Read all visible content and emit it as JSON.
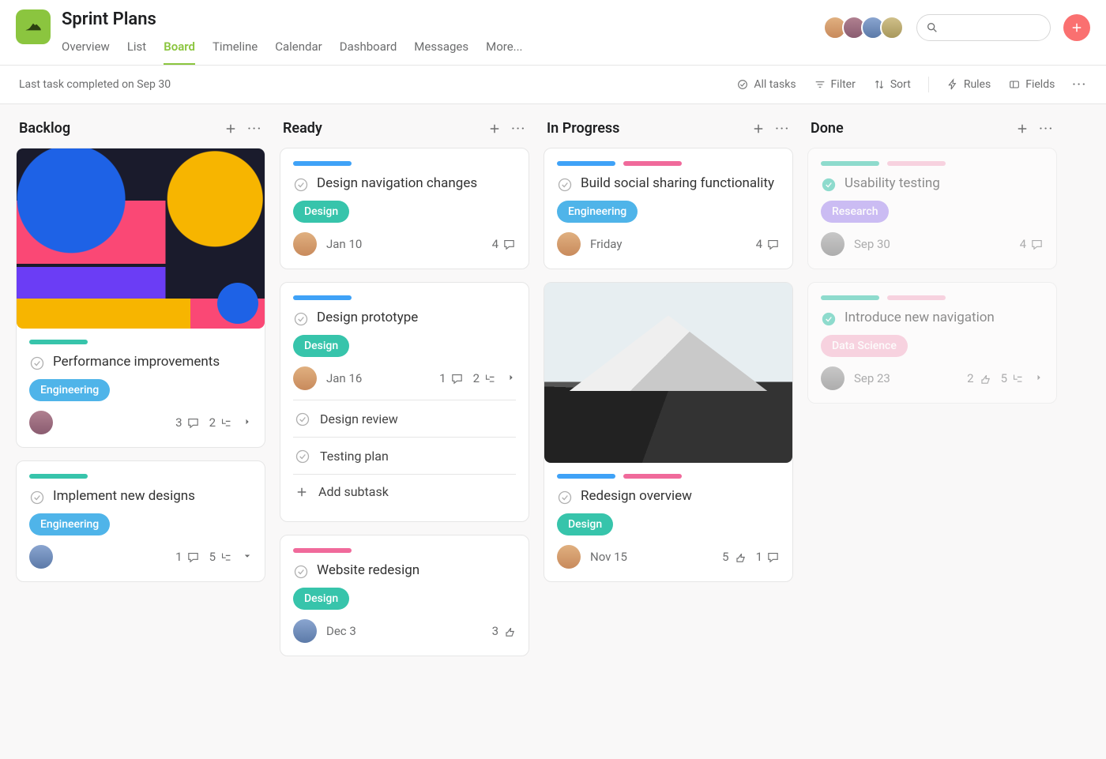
{
  "header": {
    "project_title": "Sprint Plans",
    "tabs": [
      "Overview",
      "List",
      "Board",
      "Timeline",
      "Calendar",
      "Dashboard",
      "Messages",
      "More..."
    ],
    "active_tab": "Board",
    "search_placeholder": ""
  },
  "toolbar": {
    "status_text": "Last task completed on Sep 30",
    "all_tasks": "All tasks",
    "filter": "Filter",
    "sort": "Sort",
    "rules": "Rules",
    "fields": "Fields"
  },
  "columns": [
    {
      "title": "Backlog",
      "cards": [
        {
          "cover": "abstract",
          "strips": [
            "teal"
          ],
          "title": "Performance improvements",
          "tags": [
            {
              "label": "Engineering",
              "kind": "eng"
            }
          ],
          "avatar": "c2",
          "date": "",
          "stats": {
            "comments": 3,
            "subtasks": 2,
            "caret": "right"
          },
          "done": false
        },
        {
          "strips": [
            "teal"
          ],
          "title": "Implement new designs",
          "tags": [
            {
              "label": "Engineering",
              "kind": "eng"
            }
          ],
          "avatar": "c3",
          "date": "",
          "stats": {
            "comments": 1,
            "subtasks": 5,
            "caret": "down"
          },
          "done": false
        }
      ]
    },
    {
      "title": "Ready",
      "cards": [
        {
          "strips": [
            "blue"
          ],
          "title": "Design navigation changes",
          "tags": [
            {
              "label": "Design",
              "kind": "design"
            }
          ],
          "avatar": "c1",
          "date": "Jan 10",
          "stats": {
            "comments": 4
          },
          "done": false
        },
        {
          "strips": [
            "blue"
          ],
          "title": "Design prototype",
          "tags": [
            {
              "label": "Design",
              "kind": "design"
            }
          ],
          "avatar": "c1",
          "date": "Jan 16",
          "stats": {
            "comments": 1,
            "subtasks": 2,
            "caret": "right"
          },
          "done": false,
          "subtasks": [
            {
              "title": "Design review"
            },
            {
              "title": "Testing plan"
            }
          ],
          "add_subtask_label": "Add subtask"
        },
        {
          "strips": [
            "pink"
          ],
          "title": "Website redesign",
          "tags": [
            {
              "label": "Design",
              "kind": "design"
            }
          ],
          "avatar": "c3",
          "date": "Dec 3",
          "stats": {
            "likes": 3
          },
          "done": false
        }
      ]
    },
    {
      "title": "In Progress",
      "cards": [
        {
          "strips": [
            "blue",
            "pink"
          ],
          "title": "Build social sharing functionality",
          "tags": [
            {
              "label": "Engineering",
              "kind": "eng"
            }
          ],
          "avatar": "c1",
          "date": "Friday",
          "stats": {
            "comments": 4
          },
          "done": false
        },
        {
          "cover": "mountain",
          "strips": [
            "blue",
            "pink"
          ],
          "title": "Redesign overview",
          "tags": [
            {
              "label": "Design",
              "kind": "design"
            }
          ],
          "avatar": "c1",
          "date": "Nov 15",
          "stats": {
            "likes": 5,
            "comments": 1
          },
          "done": false
        }
      ]
    },
    {
      "title": "Done",
      "cards": [
        {
          "strips": [
            "teal",
            "pinklight"
          ],
          "title": "Usability testing",
          "tags": [
            {
              "label": "Research",
              "kind": "research"
            }
          ],
          "avatar": "c5",
          "date": "Sep 30",
          "stats": {
            "comments": 4
          },
          "done": true,
          "faded": true
        },
        {
          "strips": [
            "teal",
            "pinklight"
          ],
          "title": "Introduce new navigation",
          "tags": [
            {
              "label": "Data Science",
              "kind": "ds"
            }
          ],
          "avatar": "c5",
          "date": "Sep 23",
          "stats": {
            "likes": 2,
            "subtasks": 5,
            "caret": "right"
          },
          "done": true,
          "faded": true
        }
      ]
    }
  ]
}
